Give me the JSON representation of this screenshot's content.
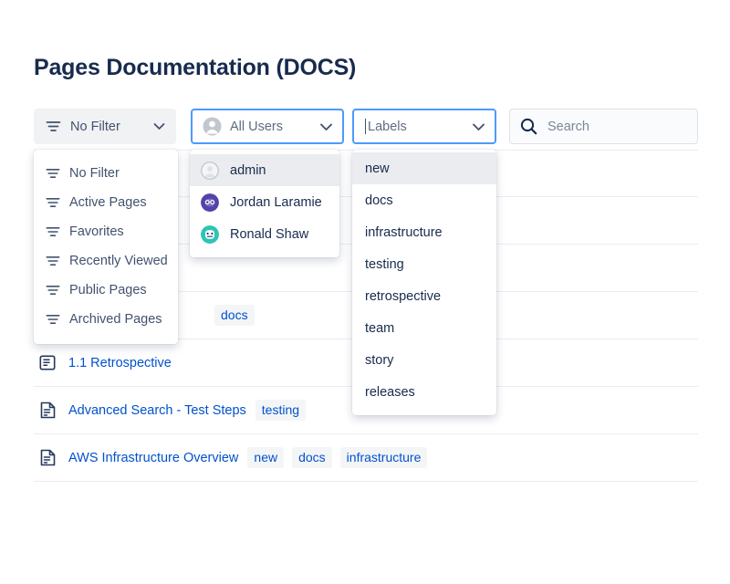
{
  "page": {
    "title": "Pages Documentation (DOCS)"
  },
  "toolbar": {
    "filter": {
      "label": "No Filter",
      "icon": "filter-icon",
      "caret": "chevron-down-icon"
    },
    "users": {
      "label": "All Users",
      "icon": "user-avatar-icon",
      "caret": "chevron-down-icon"
    },
    "labels": {
      "label": "Labels",
      "value": "",
      "caret": "chevron-down-icon"
    },
    "search": {
      "placeholder": "Search",
      "value": "",
      "icon": "search-icon"
    }
  },
  "filter_menu": {
    "items": [
      {
        "label": "No Filter",
        "icon": "filter-icon",
        "selected": true
      },
      {
        "label": "Active Pages",
        "icon": "filter-icon",
        "selected": false
      },
      {
        "label": "Favorites",
        "icon": "filter-icon",
        "selected": false
      },
      {
        "label": "Recently Viewed",
        "icon": "filter-icon",
        "selected": false
      },
      {
        "label": "Public Pages",
        "icon": "filter-icon",
        "selected": false
      },
      {
        "label": "Archived Pages",
        "icon": "filter-icon",
        "selected": false
      }
    ]
  },
  "users_menu": {
    "items": [
      {
        "label": "admin",
        "avatar": "default-avatar",
        "avatar_color": "#c1c7d0",
        "selected": true
      },
      {
        "label": "Jordan Laramie",
        "avatar": "robot-avatar",
        "avatar_color": "#5243aa",
        "selected": false
      },
      {
        "label": "Ronald Shaw",
        "avatar": "robot-avatar",
        "avatar_color": "#2ec4b6",
        "selected": false
      }
    ]
  },
  "labels_menu": {
    "items": [
      {
        "label": "new",
        "selected": true
      },
      {
        "label": "docs",
        "selected": false
      },
      {
        "label": "infrastructure",
        "selected": false
      },
      {
        "label": "testing",
        "selected": false
      },
      {
        "label": "retrospective",
        "selected": false
      },
      {
        "label": "team",
        "selected": false
      },
      {
        "label": "story",
        "selected": false
      },
      {
        "label": "releases",
        "selected": false
      }
    ]
  },
  "table": {
    "rows": [
      {
        "icon": "page-icon",
        "title": "",
        "chips": []
      },
      {
        "icon": "page-icon",
        "title": "",
        "chips": [
          {
            "label": "",
            "style": "warn"
          }
        ]
      },
      {
        "icon": "page-icon",
        "title": "",
        "chips": [
          {
            "label": "",
            "style": "normal"
          }
        ]
      },
      {
        "icon": "page-icon",
        "title": "",
        "chips": [
          {
            "label": "docs",
            "style": "normal"
          }
        ]
      },
      {
        "icon": "blog-icon",
        "title": "1.1 Retrospective",
        "chips": []
      },
      {
        "icon": "page-icon",
        "title": "Advanced Search - Test Steps",
        "chips": [
          {
            "label": "testing",
            "style": "normal"
          }
        ]
      },
      {
        "icon": "page-icon",
        "title": "AWS Infrastructure Overview",
        "chips": [
          {
            "label": "new",
            "style": "normal"
          },
          {
            "label": "docs",
            "style": "normal"
          },
          {
            "label": "infrastructure",
            "style": "normal"
          }
        ]
      }
    ]
  },
  "colors": {
    "accent": "#0052cc",
    "focus_border": "#4c9aff",
    "text_primary": "#172b4d",
    "text_secondary": "#42526e",
    "chip_bg": "#f4f5f7",
    "chip_warn_bg": "#fff0b3",
    "row_divider": "#ebecf0"
  }
}
